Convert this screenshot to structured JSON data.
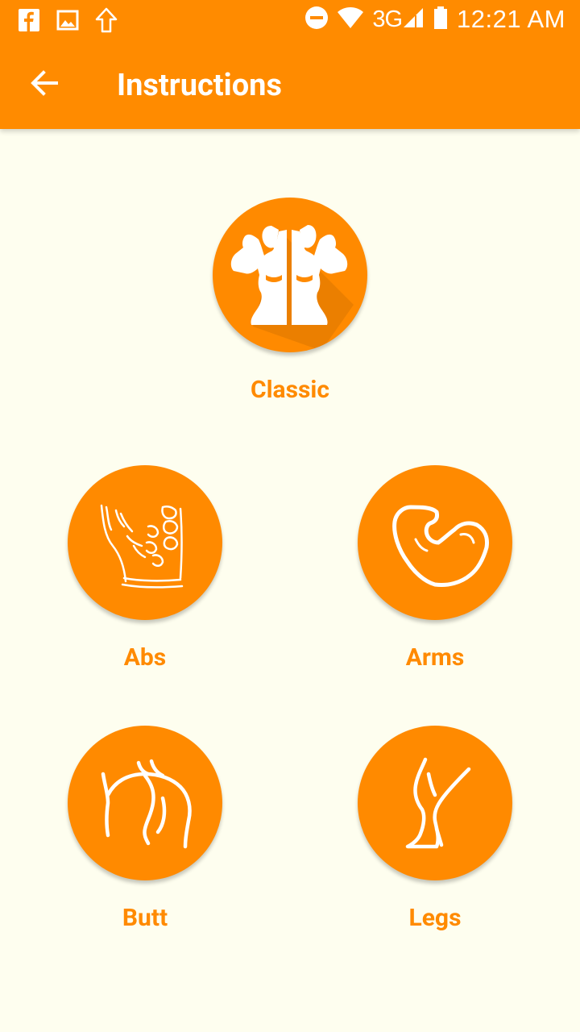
{
  "status_bar": {
    "time": "12:21 AM",
    "network": "3G",
    "icons": [
      "facebook-icon",
      "image-icon",
      "upload-icon",
      "dnd-icon",
      "wifi-icon",
      "signal-icon",
      "battery-icon"
    ]
  },
  "toolbar": {
    "title": "Instructions",
    "back_icon": "arrow-back-icon"
  },
  "colors": {
    "primary": "#ff8b00",
    "background": "#fefeef",
    "label": "#ff8a00"
  },
  "categories": [
    {
      "label": "Classic",
      "icon": "bodybuilder-icon"
    },
    {
      "label": "Abs",
      "icon": "abs-icon"
    },
    {
      "label": "Arms",
      "icon": "biceps-icon"
    },
    {
      "label": "Butt",
      "icon": "butt-icon"
    },
    {
      "label": "Legs",
      "icon": "leg-icon"
    }
  ]
}
